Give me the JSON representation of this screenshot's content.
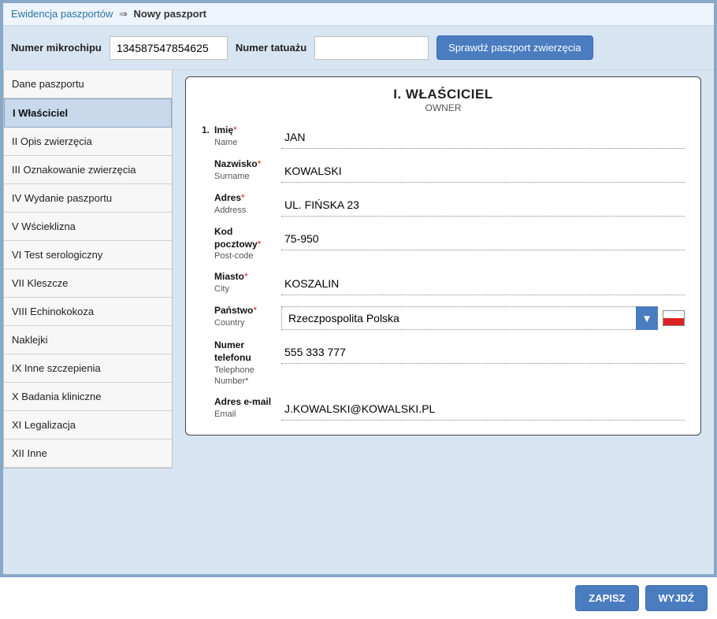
{
  "breadcrumb": {
    "root": "Ewidencja paszportów",
    "arrow": "⇒",
    "current": "Nowy paszport"
  },
  "search": {
    "microchip_label": "Numer mikrochipu",
    "microchip_value": "134587547854625",
    "tattoo_label": "Numer tatuażu",
    "tattoo_value": "",
    "check_button": "Sprawdź paszport zwierzęcia"
  },
  "sidebar": {
    "items": [
      "Dane paszportu",
      "I Właściciel",
      "II Opis zwierzęcia",
      "III Oznakowanie zwierzęcia",
      "IV Wydanie paszportu",
      "V Wścieklizna",
      "VI Test serologiczny",
      "VII Kleszcze",
      "VIII Echinokokoza",
      "Naklejki",
      "IX Inne szczepienia",
      "X Badania kliniczne",
      "XI Legalizacja",
      "XII Inne"
    ],
    "active_index": 1
  },
  "panel": {
    "title": "I. WŁAŚCICIEL",
    "subtitle": "OWNER",
    "row_number": "1.",
    "fields": {
      "imie": {
        "label": "Imię",
        "sub": "Name",
        "required": true,
        "value": "JAN"
      },
      "nazwisko": {
        "label": "Nazwisko",
        "sub": "Surname",
        "required": true,
        "value": "KOWALSKI"
      },
      "adres": {
        "label": "Adres",
        "sub": "Address",
        "required": true,
        "value": "UL. FIŃSKA 23"
      },
      "kod": {
        "label": "Kod pocztowy",
        "sub": "Post-code",
        "required": true,
        "value": "75-950"
      },
      "miasto": {
        "label": "Miasto",
        "sub": "City",
        "required": true,
        "value": "KOSZALIN"
      },
      "panstwo": {
        "label": "Państwo",
        "sub": "Country",
        "required": true,
        "value": "Rzeczpospolita Polska"
      },
      "telefon": {
        "label": "Numer telefonu",
        "sub": "Telephone Number*",
        "required": false,
        "value": "555 333 777"
      },
      "email": {
        "label": "Adres e-mail",
        "sub": "Email",
        "required": false,
        "value": "J.KOWALSKI@KOWALSKI.PL"
      }
    }
  },
  "footer": {
    "save": "ZAPISZ",
    "exit": "WYJDŹ"
  }
}
